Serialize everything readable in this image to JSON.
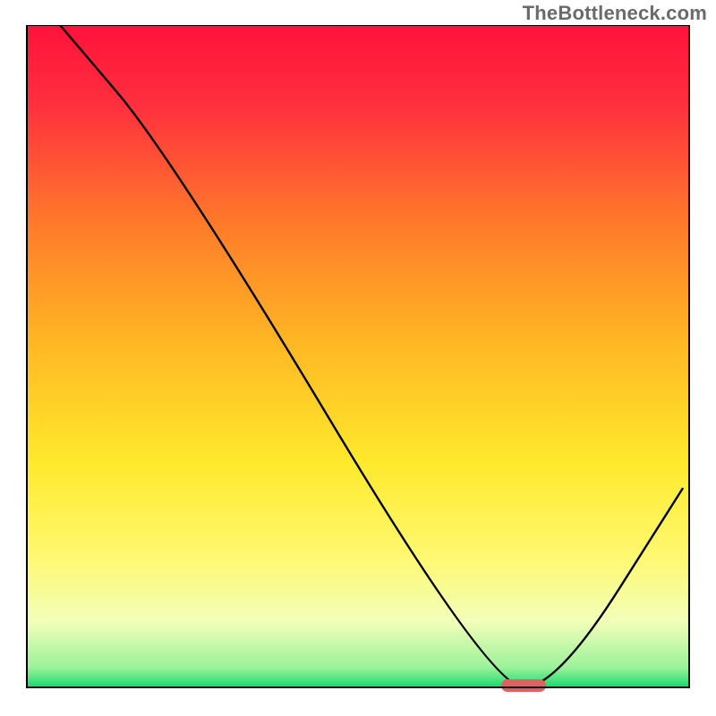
{
  "watermark": "TheBottleneck.com",
  "chart_data": {
    "type": "line",
    "title": "",
    "xlabel": "",
    "ylabel": "",
    "xlim": [
      0,
      100
    ],
    "ylim": [
      0,
      100
    ],
    "grid": false,
    "background": "gradient red→orange→yellow→green",
    "series": [
      {
        "name": "curve",
        "x": [
          5,
          22,
          70,
          80,
          99
        ],
        "values": [
          100,
          80,
          0,
          0,
          30
        ],
        "color": "#000000"
      }
    ],
    "marker": {
      "center_x": 75,
      "center_y": 0,
      "color": "#e16060",
      "shape": "rounded-bar"
    },
    "gradient_stops": [
      {
        "offset": 0.0,
        "color": "#ff123b"
      },
      {
        "offset": 0.12,
        "color": "#ff2f3e"
      },
      {
        "offset": 0.3,
        "color": "#ff7a2a"
      },
      {
        "offset": 0.48,
        "color": "#ffb724"
      },
      {
        "offset": 0.66,
        "color": "#ffe92c"
      },
      {
        "offset": 0.8,
        "color": "#fff86f"
      },
      {
        "offset": 0.9,
        "color": "#f2ffb8"
      },
      {
        "offset": 0.97,
        "color": "#9cf29b"
      },
      {
        "offset": 1.0,
        "color": "#1bd96b"
      }
    ]
  }
}
